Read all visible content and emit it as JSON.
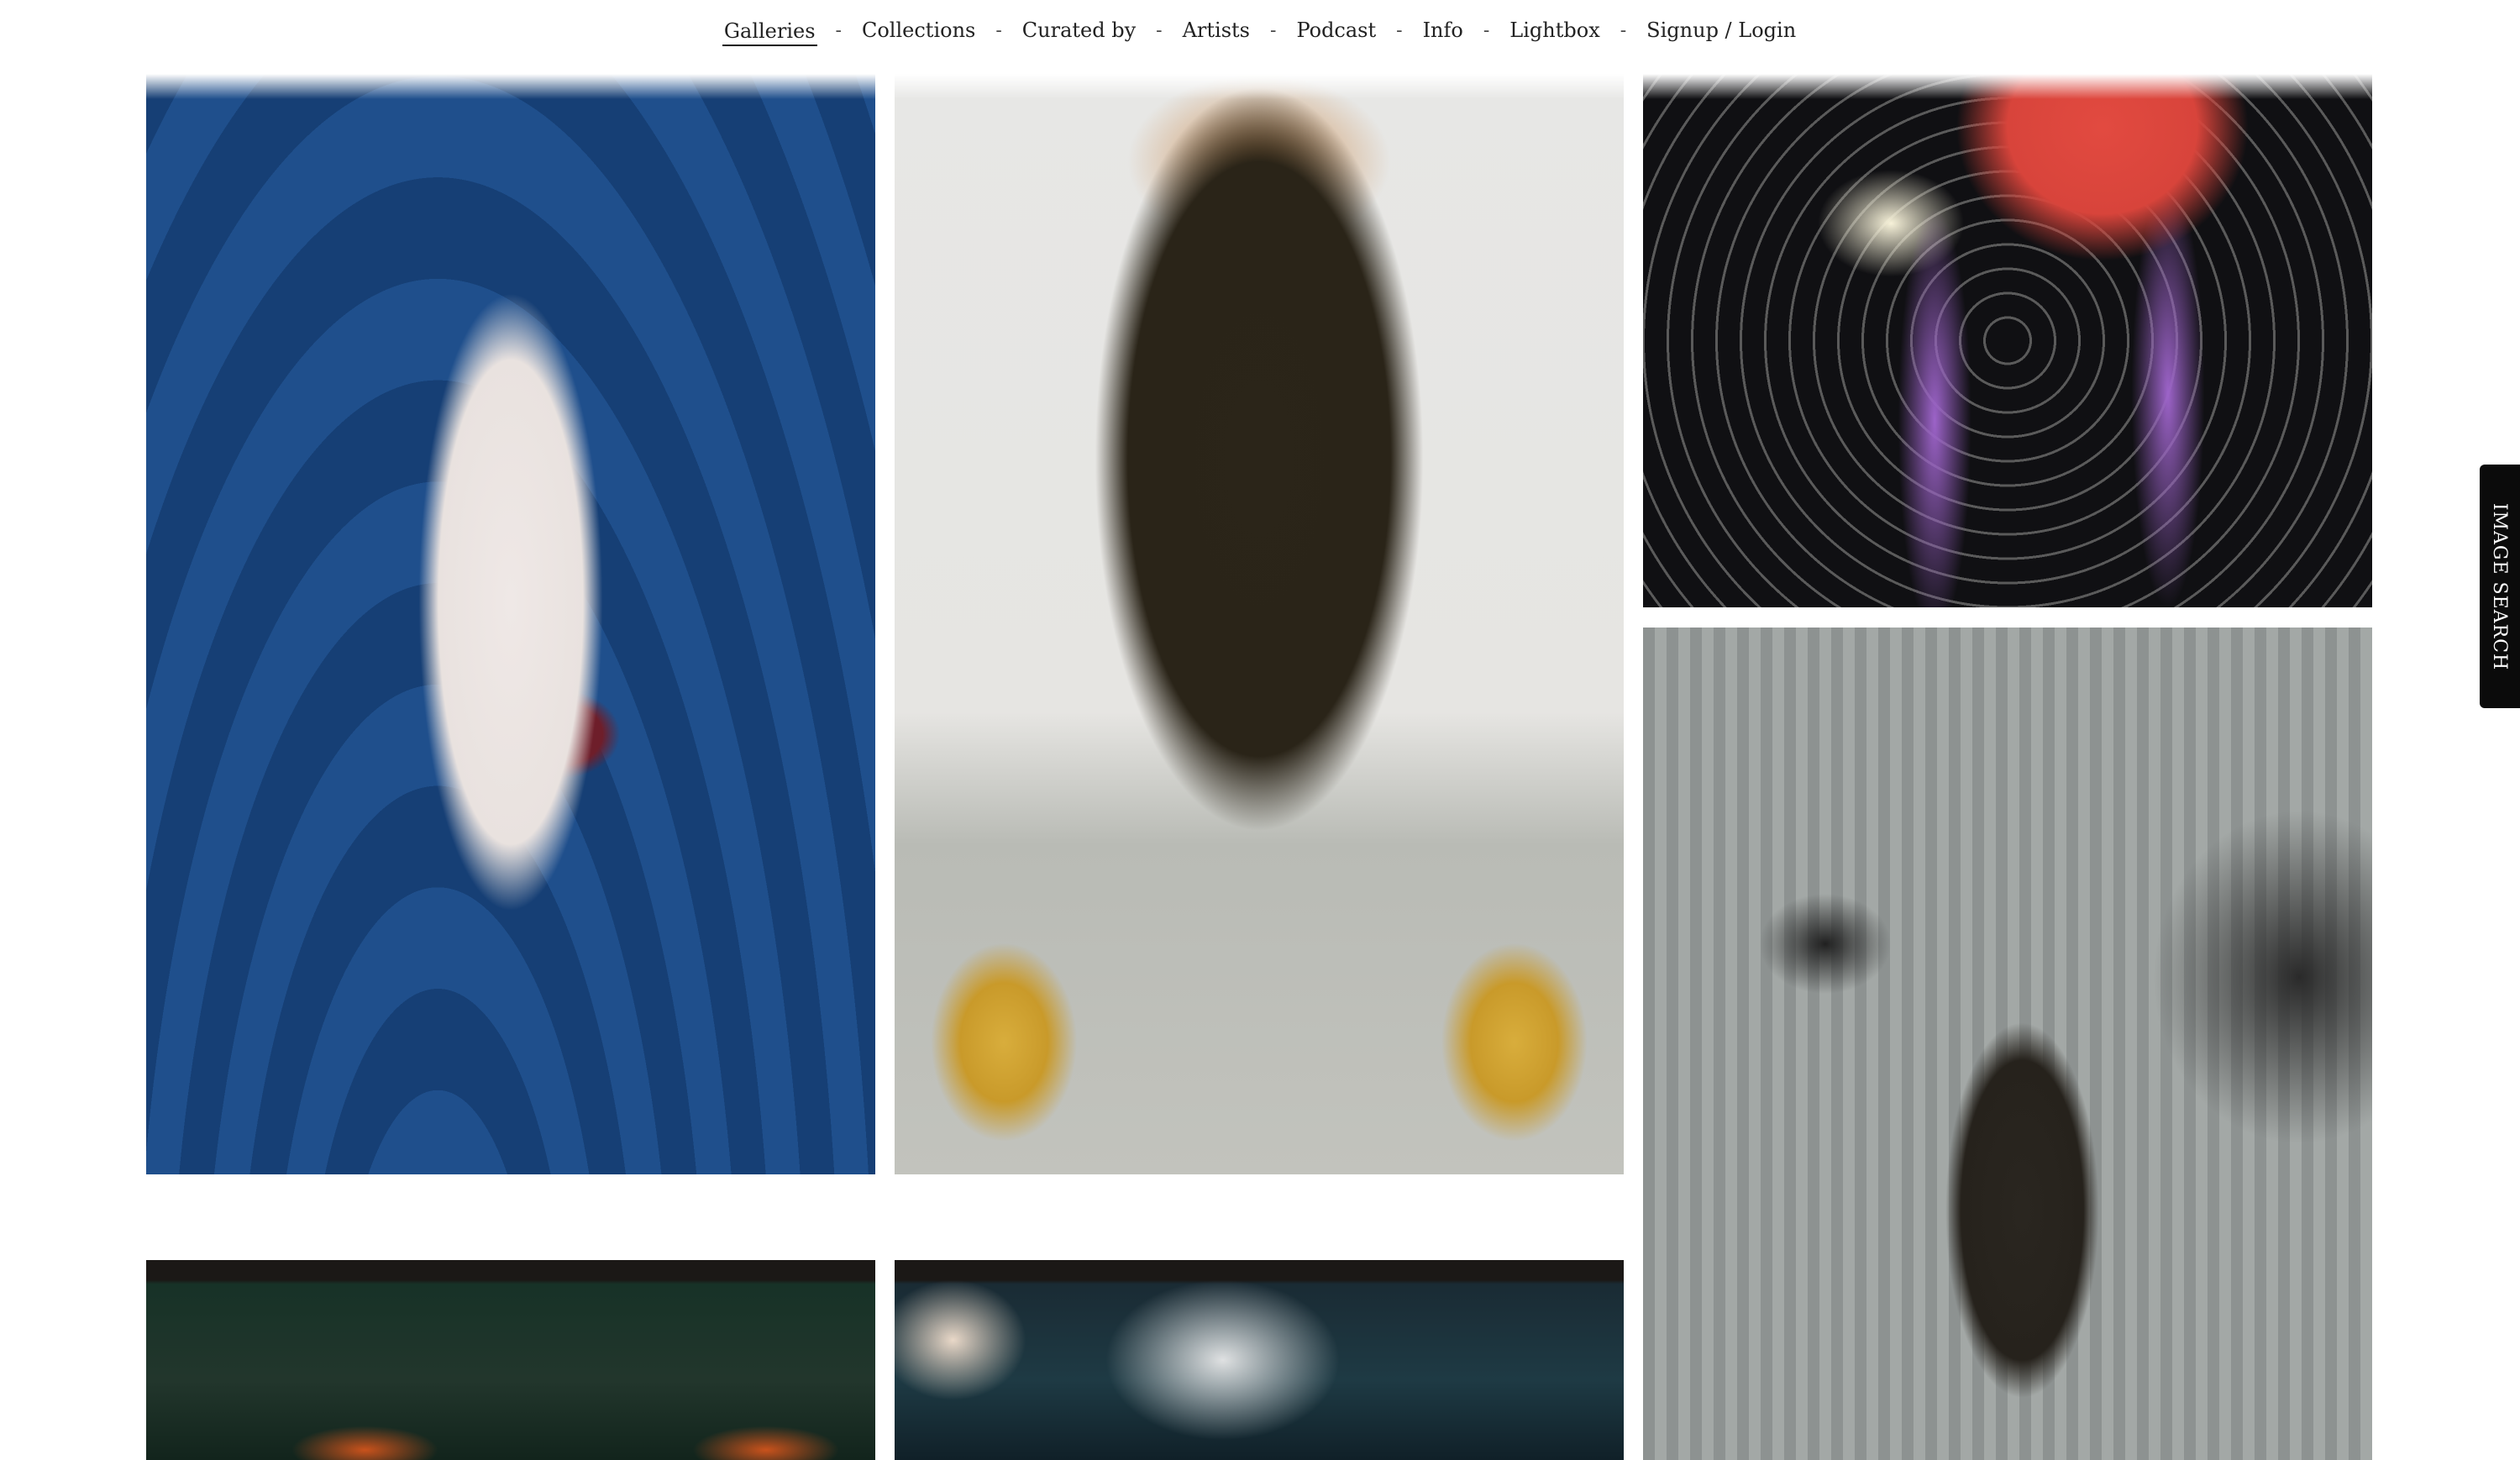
{
  "nav": {
    "items": [
      {
        "label": "Galleries",
        "active": true
      },
      {
        "label": "Collections"
      },
      {
        "label": "Curated by"
      },
      {
        "label": "Artists"
      },
      {
        "label": "Podcast"
      },
      {
        "label": "Info"
      },
      {
        "label": "Lightbox"
      },
      {
        "label": "Signup / Login"
      }
    ],
    "separator": "-"
  },
  "side_tab": {
    "label": "IMAGE SEARCH"
  },
  "gallery": {
    "tiles": [
      {
        "description_icon": "photo-theater-suit"
      },
      {
        "description_icon": "photo-gold-shoes"
      },
      {
        "description_icon": "photo-purple-boots"
      },
      {
        "description_icon": "photo-woman-floor"
      },
      {
        "description_icon": "photo-green-interior"
      },
      {
        "description_icon": "photo-dark-interior"
      }
    ]
  }
}
